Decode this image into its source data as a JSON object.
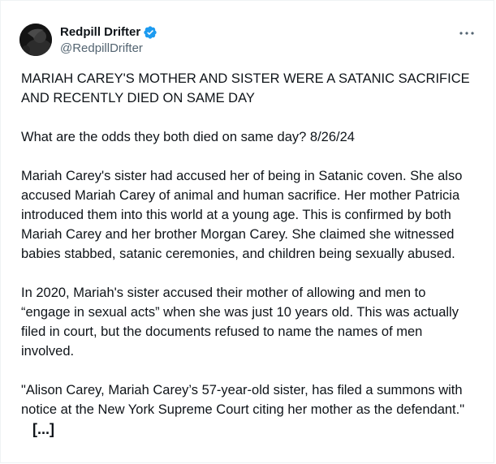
{
  "post": {
    "author": {
      "display_name": "Redpill Drifter",
      "handle": "@RedpillDrifter",
      "verified": true,
      "avatar_icon": "avatar-image"
    },
    "more_icon": "more-horizontal-icon",
    "paragraphs": [
      "MARIAH CAREY'S MOTHER AND SISTER WERE A SATANIC SACRIFICE AND RECENTLY DIED ON SAME DAY",
      "What are the odds they both died on same day? 8/26/24",
      "Mariah Carey's sister had accused her of being in Satanic coven. She also accused Mariah Carey of animal and human sacrifice. Her mother Patricia introduced them into this world at a young age. This is confirmed by both Mariah Carey and her brother Morgan Carey. She claimed she witnessed babies stabbed, satanic ceremonies, and children being sexually abused.",
      "In 2020, Mariah's sister accused their mother of allowing and men to “engage in sexual acts” when she was just 10 years old. This was actually filed in court, but the documents refused to name the names of men involved.",
      "\"Alison Carey, Mariah Carey’s 57-year-old sister, has filed a summons with notice at the New York Supreme Court citing her mother as the defendant.\""
    ],
    "truncation_marker": "[...]"
  },
  "colors": {
    "text": "#0f1419",
    "secondary": "#536471",
    "verified_blue": "#1d9bf0"
  }
}
